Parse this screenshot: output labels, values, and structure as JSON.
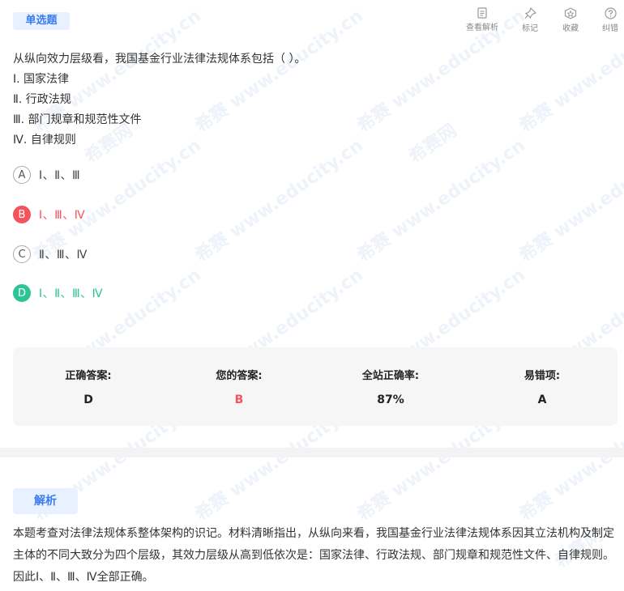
{
  "header": {
    "tag": "单选题"
  },
  "toolbar": {
    "view_analysis": "查看解析",
    "mark": "标记",
    "favorite": "收藏",
    "report_error": "纠错"
  },
  "question": {
    "stem": "从纵向效力层级看，我国基金行业法律法规体系包括（ ）。",
    "items": [
      "Ⅰ. 国家法律",
      "Ⅱ. 行政法规",
      "Ⅲ. 部门规章和规范性文件",
      "Ⅳ. 自律规则"
    ]
  },
  "options": [
    {
      "letter": "A",
      "text": "Ⅰ、Ⅱ、Ⅲ",
      "state": "normal"
    },
    {
      "letter": "B",
      "text": "Ⅰ、Ⅲ、Ⅳ",
      "state": "wrong"
    },
    {
      "letter": "C",
      "text": "Ⅱ、Ⅲ、Ⅳ",
      "state": "normal"
    },
    {
      "letter": "D",
      "text": "Ⅰ、Ⅱ、Ⅲ、Ⅳ",
      "state": "right"
    }
  ],
  "stats": {
    "correct_label": "正确答案:",
    "correct_value": "D",
    "yours_label": "您的答案:",
    "yours_value": "B",
    "rate_label": "全站正确率:",
    "rate_value": "87%",
    "error_label": "易错项:",
    "error_value": "A"
  },
  "analysis": {
    "tag": "解析",
    "text": "本题考查对法律法规体系整体架构的识记。材料清晰指出，从纵向来看，我国基金行业法律法规体系因其立法机构及制定主体的不同大致分为四个层级，其效力层级从高到低依次是：国家法律、行政法规、部门规章和规范性文件、自律规则。因此Ⅰ、Ⅱ、Ⅲ、Ⅳ全部正确。"
  },
  "watermark": {
    "text": "希赛 www.educity.cn",
    "text2": "希赛网"
  },
  "colors": {
    "accent": "#3a7bf0",
    "wrong": "#f4545e",
    "right": "#2ec594"
  }
}
